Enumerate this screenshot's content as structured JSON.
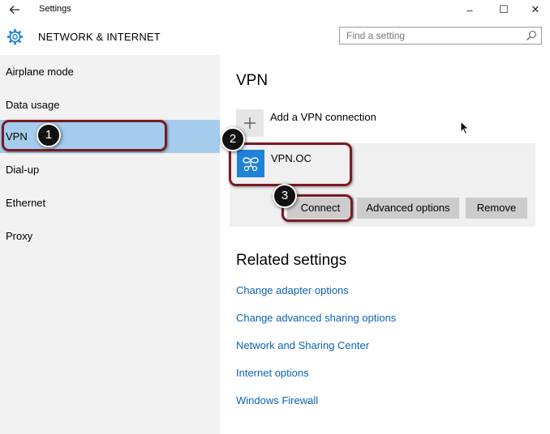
{
  "window": {
    "title": "Settings",
    "minimize_glyph": "–",
    "maximize_glyph": "☐",
    "close_glyph": "✕"
  },
  "header": {
    "section": "NETWORK & INTERNET",
    "search_placeholder": "Find a setting"
  },
  "sidebar": {
    "items": [
      {
        "label": "Airplane mode"
      },
      {
        "label": "Data usage"
      },
      {
        "label": "VPN"
      },
      {
        "label": "Dial-up"
      },
      {
        "label": "Ethernet"
      },
      {
        "label": "Proxy"
      }
    ]
  },
  "vpn": {
    "heading": "VPN",
    "add_label": "Add a VPN connection",
    "connection_name": "VPN.OC",
    "buttons": {
      "connect": "Connect",
      "advanced": "Advanced options",
      "remove": "Remove"
    }
  },
  "related": {
    "heading": "Related settings",
    "links": [
      "Change adapter options",
      "Change advanced sharing options",
      "Network and Sharing Center",
      "Internet options",
      "Windows Firewall"
    ]
  },
  "callouts": [
    "1",
    "2",
    "3"
  ],
  "colors": {
    "accent": "#1e82d7",
    "selected_nav": "#a5ccec",
    "link": "#0b63b5",
    "highlight_border": "#7a1a22"
  }
}
